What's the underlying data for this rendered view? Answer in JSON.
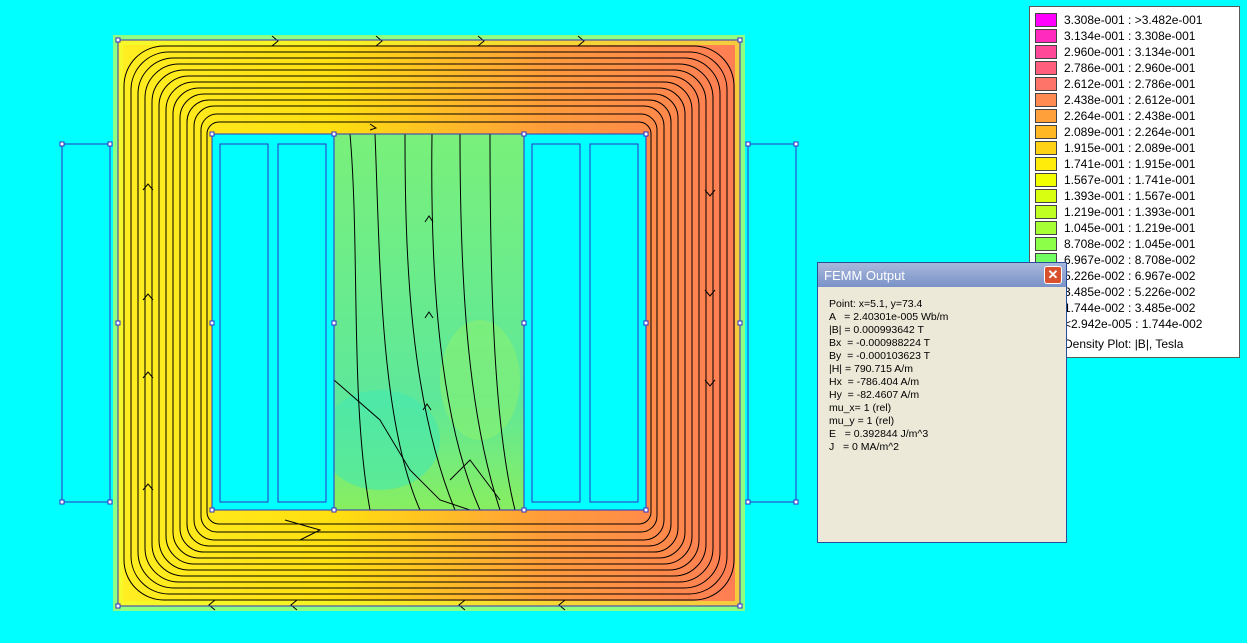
{
  "legend": {
    "entries": [
      {
        "label": "3.308e-001 : >3.482e-001",
        "color": "#ff00ff"
      },
      {
        "label": "3.134e-001 : 3.308e-001",
        "color": "#ff2bbe"
      },
      {
        "label": "2.960e-001 : 3.134e-001",
        "color": "#ff4898"
      },
      {
        "label": "2.786e-001 : 2.960e-001",
        "color": "#ff5f7c"
      },
      {
        "label": "2.612e-001 : 2.786e-001",
        "color": "#ff7468"
      },
      {
        "label": "2.438e-001 : 2.612e-001",
        "color": "#ff8a52"
      },
      {
        "label": "2.264e-001 : 2.438e-001",
        "color": "#ffa03a"
      },
      {
        "label": "2.089e-001 : 2.264e-001",
        "color": "#ffb824"
      },
      {
        "label": "1.915e-001 : 2.089e-001",
        "color": "#ffd216"
      },
      {
        "label": "1.741e-001 : 1.915e-001",
        "color": "#ffec0a"
      },
      {
        "label": "1.567e-001 : 1.741e-001",
        "color": "#f2ff00"
      },
      {
        "label": "1.393e-001 : 1.567e-001",
        "color": "#d8ff10"
      },
      {
        "label": "1.219e-001 : 1.393e-001",
        "color": "#c0ff22"
      },
      {
        "label": "1.045e-001 : 1.219e-001",
        "color": "#a6ff34"
      },
      {
        "label": "8.708e-002 : 1.045e-001",
        "color": "#8cff48"
      },
      {
        "label": "6.967e-002 : 8.708e-002",
        "color": "#72ff62"
      },
      {
        "label": "5.226e-002 : 6.967e-002",
        "color": "#5aff80"
      },
      {
        "label": "3.485e-002 : 5.226e-002",
        "color": "#3cffa4"
      },
      {
        "label": "1.744e-002 : 3.485e-002",
        "color": "#1effcc"
      },
      {
        "label": "<2.942e-005 : 1.744e-002",
        "color": "#00ffff"
      }
    ],
    "title": "Density Plot: |B|, Tesla"
  },
  "output_window": {
    "title": "FEMM Output",
    "close_glyph": "✕",
    "lines": [
      "Point: x=5.1, y=73.4",
      "A   = 2.40301e-005 Wb/m",
      "|B| = 0.000993642 T",
      "Bx  = -0.000988224 T",
      "By  = -0.000103623 T",
      "|H| = 790.715 A/m",
      "Hx  = -786.404 A/m",
      "Hy  = -82.4607 A/m",
      "mu_x= 1 (rel)",
      "mu_y = 1 (rel)",
      "E   = 0.392844 J/m^3",
      "J   = 0 MA/m^2"
    ]
  },
  "colors": {
    "background": "#00ffff",
    "core_yellow": "#ffff00",
    "core_orange": "#ff8c4a",
    "center_green": "#66ee88",
    "outline": "#3030c0",
    "flux_line": "#000000"
  }
}
